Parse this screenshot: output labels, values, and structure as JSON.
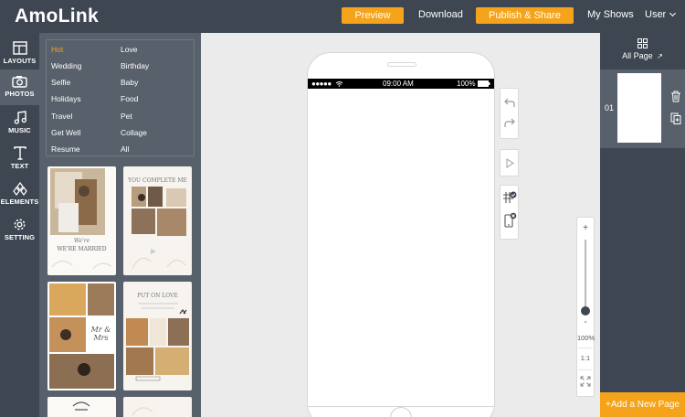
{
  "app": {
    "title": "AmoLink"
  },
  "topbar": {
    "preview_label": "Preview",
    "download_label": "Download",
    "publish_label": "Publish & Share",
    "myshows_label": "My Shows",
    "user_label": "User"
  },
  "tools": [
    {
      "label": "LAYOUTS",
      "icon": "layouts-icon"
    },
    {
      "label": "PHOTOS",
      "icon": "camera-icon"
    },
    {
      "label": "MUSIC",
      "icon": "music-note-icon"
    },
    {
      "label": "TEXT",
      "icon": "text-icon"
    },
    {
      "label": "ELEMENTS",
      "icon": "elements-icon"
    },
    {
      "label": "SETTING",
      "icon": "gear-icon"
    }
  ],
  "categories": {
    "left": [
      "Hot",
      "Wedding",
      "Selfie",
      "Holidays",
      "Travel",
      "Get Well",
      "Resume"
    ],
    "right": [
      "Love",
      "Birthday",
      "Baby",
      "Food",
      "Pet",
      "Collage",
      "All"
    ],
    "selected": "Hot"
  },
  "templates": [
    {
      "caption": "WE'RE MARRIED",
      "script": "We're"
    },
    {
      "caption": "YOU COMPLETE ME"
    },
    {
      "caption": "Mr & Mrs"
    },
    {
      "caption": "PUT ON LOVE"
    }
  ],
  "statusbar": {
    "time": "09:00  AM",
    "battery": "100%"
  },
  "zoom": {
    "plus": "+",
    "minus": "-",
    "level": "100%",
    "ratio": "1:1",
    "level_fraction": 0.0
  },
  "pages": {
    "all_label": "All Page",
    "items": [
      {
        "number": "01"
      }
    ],
    "add_label": "+Add a New Page"
  },
  "colors": {
    "accent": "#f5a31a",
    "dark": "#3e4651",
    "mid": "#58606b"
  }
}
